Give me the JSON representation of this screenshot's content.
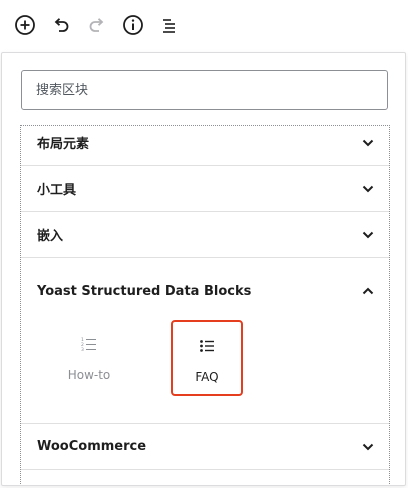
{
  "toolbar": {
    "add_block": "plus-circle-icon",
    "undo": "undo-icon",
    "redo": "redo-icon",
    "info": "info-icon",
    "outline": "list-outline-icon"
  },
  "inserter": {
    "search_placeholder": "搜索区块",
    "categories": [
      {
        "label": "布局元素",
        "expanded": false
      },
      {
        "label": "小工具",
        "expanded": false
      },
      {
        "label": "嵌入",
        "expanded": false
      },
      {
        "label": "Yoast Structured Data Blocks",
        "expanded": true
      },
      {
        "label": "WooCommerce",
        "expanded": false
      }
    ],
    "yoast_blocks": [
      {
        "label": "How-to",
        "icon": "ordered-list-icon",
        "highlighted": false
      },
      {
        "label": "FAQ",
        "icon": "unordered-list-icon",
        "highlighted": true
      }
    ]
  },
  "colors": {
    "highlight_border": "#e53e1e",
    "text": "#1e1e1e",
    "muted_text": "#8c8f94",
    "divider": "#e0e0e0"
  }
}
